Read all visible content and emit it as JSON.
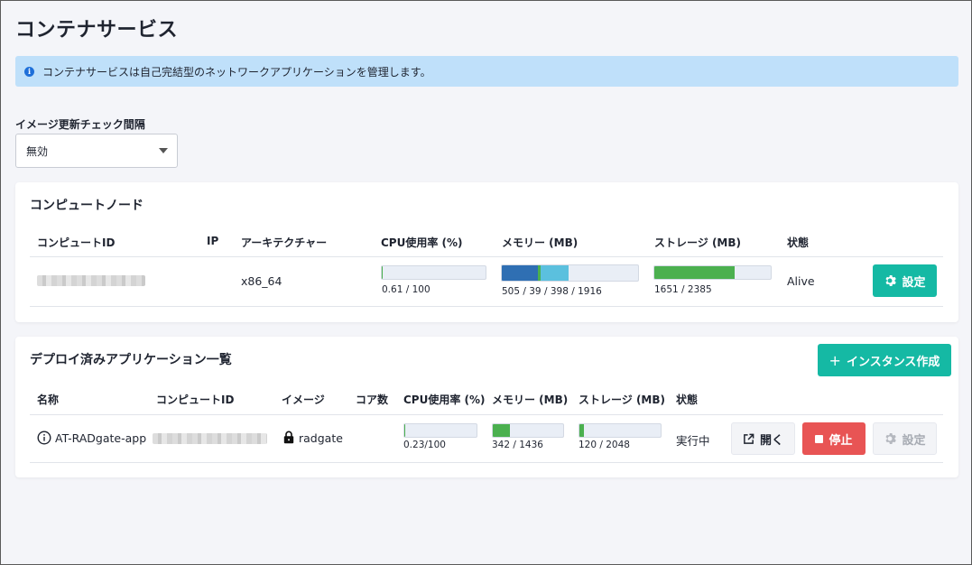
{
  "page": {
    "title": "コンテナサービス"
  },
  "banner": {
    "text": "コンテナサービスは自己完結型のネットワークアプリケーションを管理します。"
  },
  "update_check": {
    "label": "イメージ更新チェック間隔",
    "selected": "無効"
  },
  "nodes": {
    "title": "コンピュートノード",
    "columns": [
      "コンピュートID",
      "IP",
      "アーキテクチャー",
      "CPU使用率 (%)",
      "メモリー (MB)",
      "ストレージ (MB)",
      "状態"
    ],
    "rows": [
      {
        "arch": "x86_64",
        "cpu_text": "0.61 / 100",
        "cpu_fraction": 0.006,
        "mem_text": "505 / 39 / 398 / 1916",
        "mem_fractions": [
          0.264,
          0.02,
          0.208
        ],
        "storage_text": "1651 / 2385",
        "storage_fraction": 0.692,
        "status": "Alive",
        "settings_label": "設定"
      }
    ]
  },
  "apps": {
    "title": "デプロイ済みアプリケーション一覧",
    "create_label": "インスタンス作成",
    "columns": [
      "名称",
      "コンピュートID",
      "イメージ",
      "コア数",
      "CPU使用率 (%)",
      "メモリー (MB)",
      "ストレージ (MB)",
      "状態"
    ],
    "rows": [
      {
        "name": "AT-RADgate-app",
        "image": "radgate",
        "cores": "",
        "cpu_text": "0.23/100",
        "cpu_fraction": 0.0023,
        "mem_text": "342 / 1436",
        "mem_fraction": 0.238,
        "storage_text": "120 / 2048",
        "storage_fraction": 0.059,
        "status": "実行中",
        "open_label": "開く",
        "stop_label": "停止",
        "settings_label": "設定"
      }
    ]
  },
  "colors": {
    "teal": "#15b9a4",
    "red": "#e85454",
    "mem_blue": "#2f6fb3",
    "mem_green": "#4bb04f",
    "mem_cyan": "#5bc0de",
    "storage_green": "#4bb04f"
  }
}
